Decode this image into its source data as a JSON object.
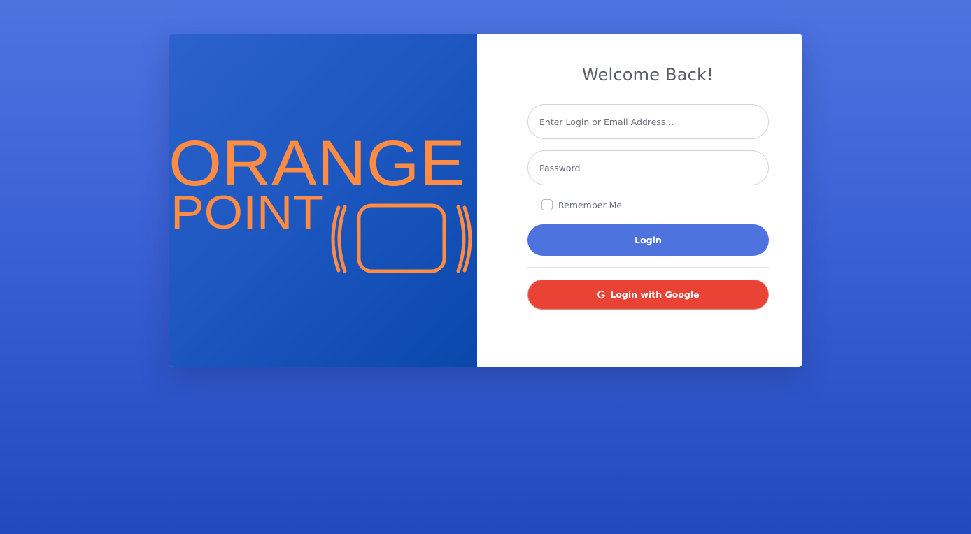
{
  "brand": {
    "logo_line1": "ORANGE",
    "logo_line2": "POINT",
    "logo_color": "#ff8c42"
  },
  "form": {
    "title": "Welcome Back!",
    "email_placeholder": "Enter Login or Email Address...",
    "password_placeholder": "Password",
    "remember_label": "Remember Me",
    "remember_checked": false,
    "login_label": "Login",
    "google_label": "Login with Google"
  },
  "colors": {
    "primary": "#4e73df",
    "google": "#ea4335",
    "text": "#5a5c69"
  },
  "icons": {
    "brand_logo": "orange-point-logo",
    "google": "google-g-icon"
  }
}
